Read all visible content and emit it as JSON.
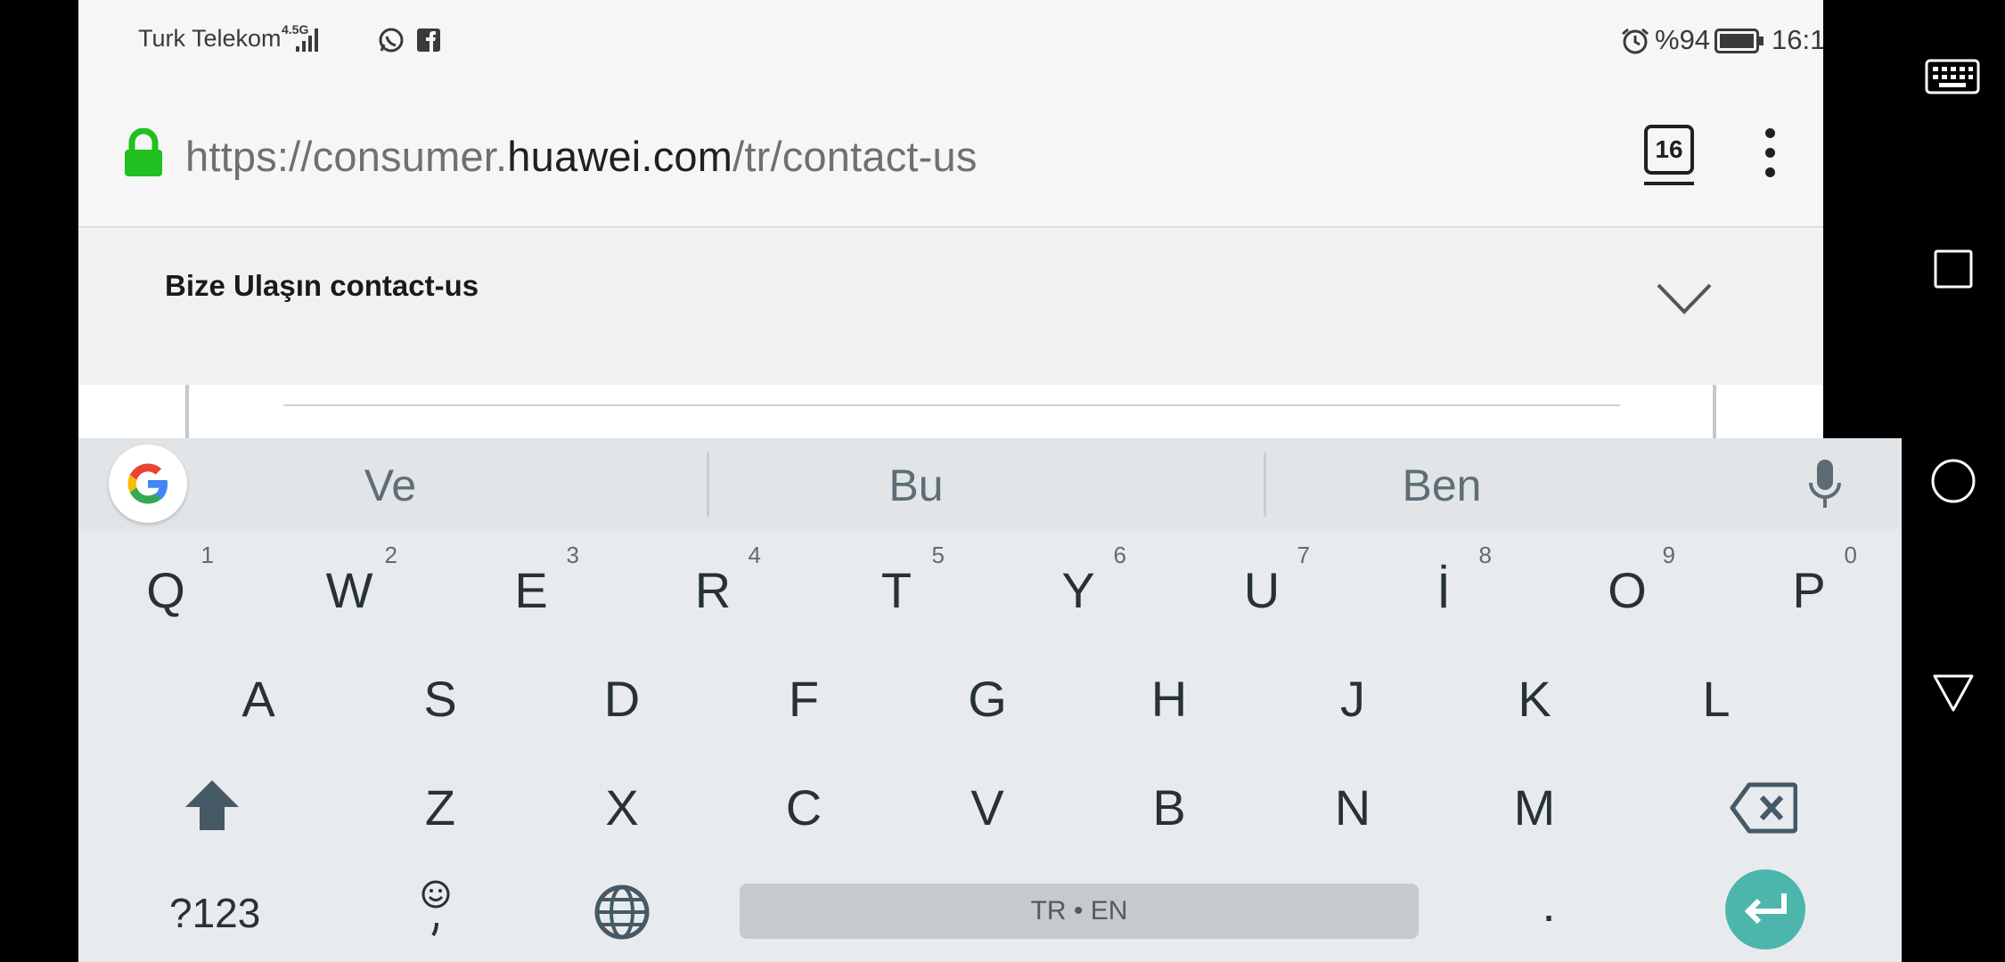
{
  "status_bar": {
    "carrier": "Turk Telekom",
    "network": "4.5G",
    "battery": "%94",
    "time": "16:1"
  },
  "url_bar": {
    "url_prefix": "https://consumer.",
    "url_host": "huawei.com",
    "url_path": "/tr/contact-us",
    "tab_count": "16"
  },
  "page": {
    "title": "Bize Ulaşın contact-us"
  },
  "keyboard": {
    "suggestions": [
      "Ve",
      "Bu",
      "Ben"
    ],
    "row1": [
      {
        "label": "Q",
        "hint": "1"
      },
      {
        "label": "W",
        "hint": "2"
      },
      {
        "label": "E",
        "hint": "3"
      },
      {
        "label": "R",
        "hint": "4"
      },
      {
        "label": "T",
        "hint": "5"
      },
      {
        "label": "Y",
        "hint": "6"
      },
      {
        "label": "U",
        "hint": "7"
      },
      {
        "label": "İ",
        "hint": "8"
      },
      {
        "label": "O",
        "hint": "9"
      },
      {
        "label": "P",
        "hint": "0"
      }
    ],
    "row2": [
      "A",
      "S",
      "D",
      "F",
      "G",
      "H",
      "J",
      "K",
      "L"
    ],
    "row3": [
      "Z",
      "X",
      "C",
      "V",
      "B",
      "N",
      "M"
    ],
    "num_key": "?123",
    "space_label": "TR • EN",
    "period": ".",
    "accent_color": "#4db6ac"
  },
  "nav_bar": {
    "icons": [
      "keyboard-icon",
      "recent-apps-icon",
      "home-icon",
      "back-icon"
    ]
  }
}
